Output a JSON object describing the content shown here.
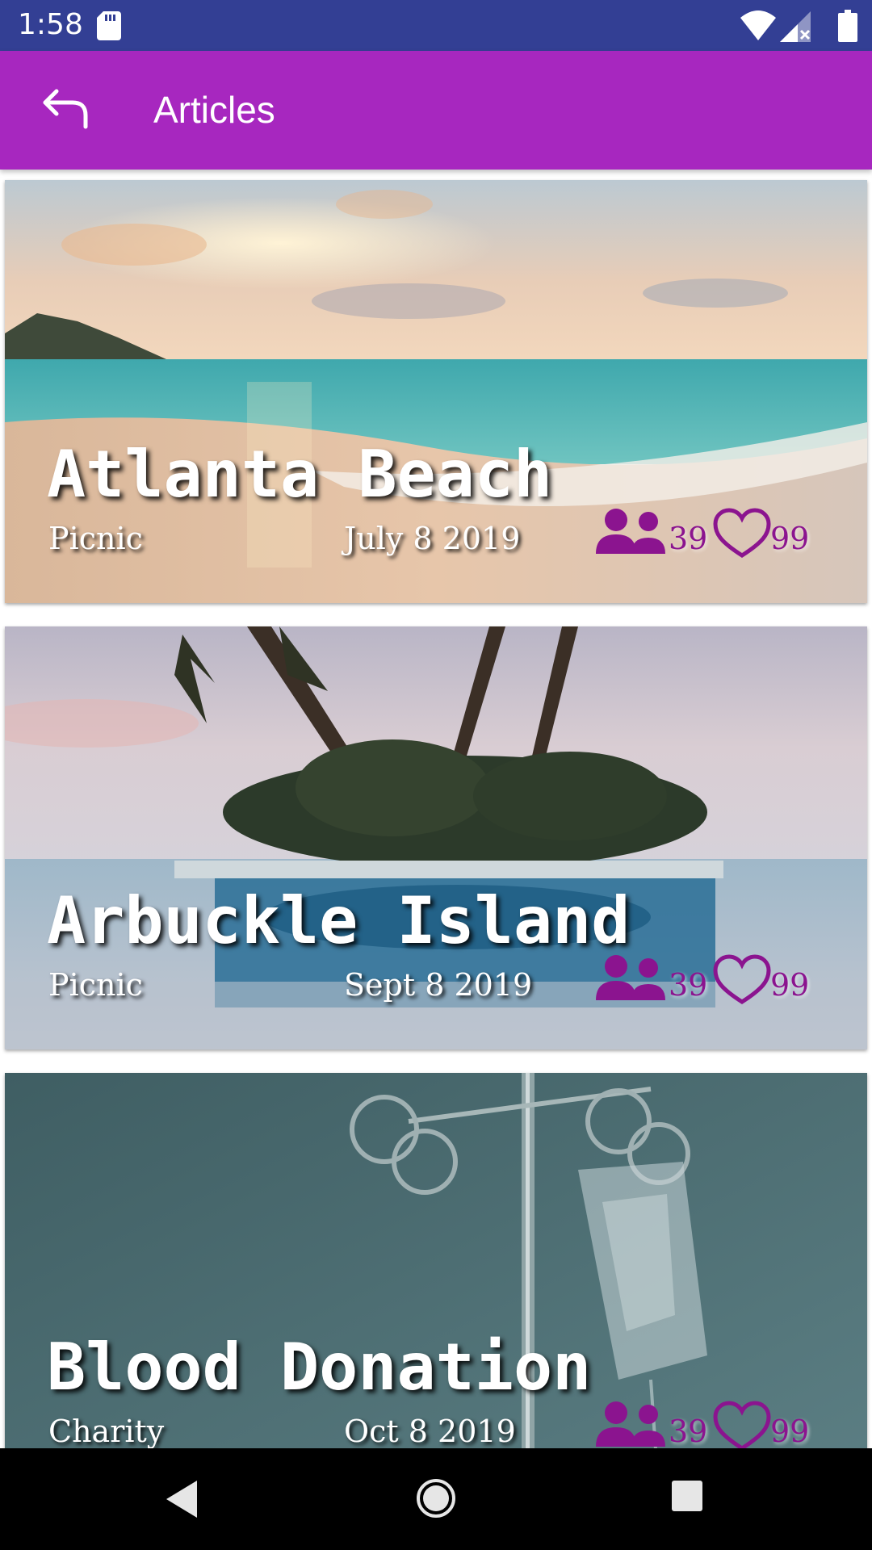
{
  "status_bar": {
    "time": "1:58",
    "icons": [
      "sd-card-icon",
      "wifi-icon",
      "signal-no-data-icon",
      "battery-icon"
    ]
  },
  "app_bar": {
    "title": "Articles",
    "back_icon": "back-arrow-icon"
  },
  "articles": [
    {
      "title": "Atlanta Beach",
      "category": "Picnic",
      "date": "July 8 2019",
      "people": "39",
      "likes": "99",
      "image": "beach-sunset"
    },
    {
      "title": "Arbuckle Island",
      "category": "Picnic",
      "date": "Sept 8 2019",
      "people": "39",
      "likes": "99",
      "image": "palm-island-pool"
    },
    {
      "title": "Blood Donation",
      "category": "Charity",
      "date": "Oct 8 2019",
      "people": "39",
      "likes": "99",
      "image": "iv-drip-stand"
    }
  ],
  "colors": {
    "status_bar": "#333f94",
    "app_bar": "#a727bf",
    "accent": "#8b148f"
  },
  "nav_bar": {
    "icons": [
      "nav-back-icon",
      "nav-home-icon",
      "nav-recents-icon"
    ]
  }
}
